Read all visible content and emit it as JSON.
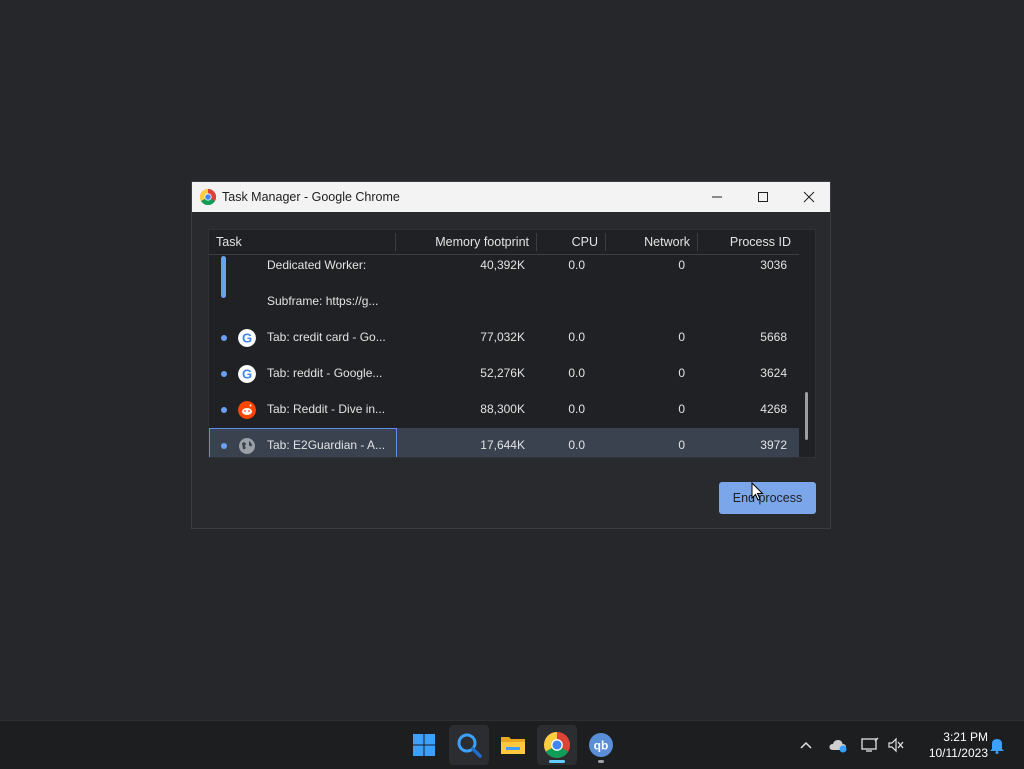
{
  "window": {
    "title": "Task Manager - Google Chrome"
  },
  "table": {
    "columns": [
      "Task",
      "Memory footprint",
      "CPU",
      "Network",
      "Process ID"
    ],
    "rows": [
      {
        "task": "Dedicated Worker:",
        "memory": "40,392K",
        "cpu": "0.0",
        "network": "0",
        "pid": "3036",
        "icon": "none",
        "group": "start"
      },
      {
        "task": "Subframe: https://g...",
        "memory": "",
        "cpu": "",
        "network": "",
        "pid": "",
        "icon": "none",
        "group": "end"
      },
      {
        "task": "Tab: credit card - Go...",
        "memory": "77,032K",
        "cpu": "0.0",
        "network": "0",
        "pid": "5668",
        "icon": "google-icon"
      },
      {
        "task": "Tab: reddit - Google...",
        "memory": "52,276K",
        "cpu": "0.0",
        "network": "0",
        "pid": "3624",
        "icon": "google-icon"
      },
      {
        "task": "Tab: Reddit - Dive in...",
        "memory": "88,300K",
        "cpu": "0.0",
        "network": "0",
        "pid": "4268",
        "icon": "reddit-icon"
      },
      {
        "task": "Tab: E2Guardian - A...",
        "memory": "17,644K",
        "cpu": "0.0",
        "network": "0",
        "pid": "3972",
        "icon": "globe-icon",
        "selected": true
      }
    ]
  },
  "buttons": {
    "end_process": "End process"
  },
  "taskbar": {
    "apps": [
      "windows-start-icon",
      "search-icon",
      "file-explorer-icon",
      "chrome-icon",
      "qbittorrent-icon"
    ],
    "time": "3:21 PM",
    "date": "10/11/2023"
  },
  "colors": {
    "accent": "#7ca6ea",
    "selection": "#3a4250",
    "background": "#25272b"
  }
}
